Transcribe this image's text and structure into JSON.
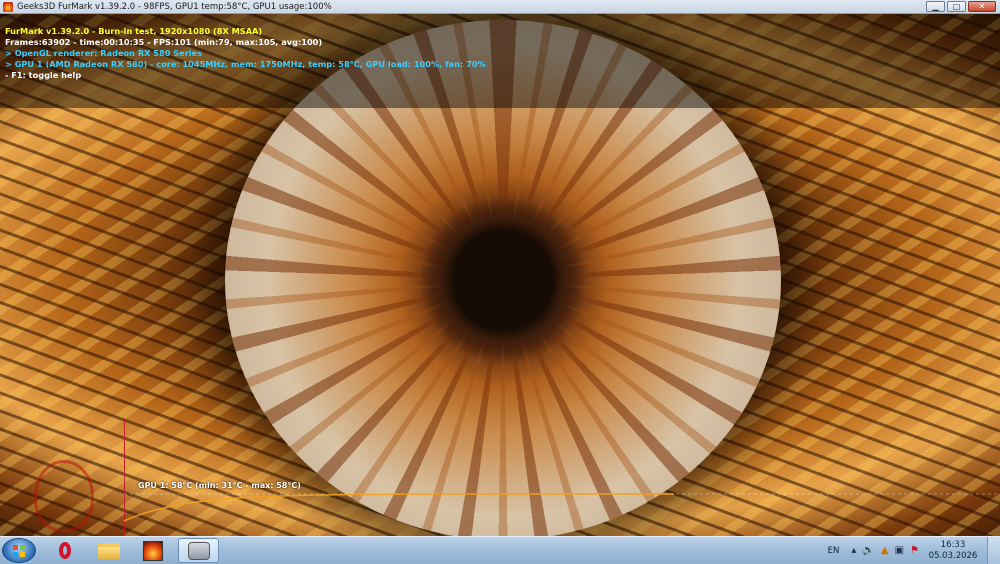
{
  "window": {
    "title": "Geeks3D FurMark v1.39.2.0 - 98FPS, GPU1 temp:58°C, GPU1 usage:100%",
    "controls": {
      "minimize": "▁",
      "maximize": "□",
      "close": "✕"
    }
  },
  "osd": {
    "lines": [
      {
        "text": "FurMark v1.39.2.0 - Burn-in test, 1920x1080 (8X MSAA)",
        "color": "#ffff30"
      },
      {
        "text": "Frames:63902 - time:00:10:35 - FPS:101 (min:79, max:105, avg:100)",
        "color": "#ffffff"
      },
      {
        "text": "> OpenGL renderer: Radeon RX 580 Series",
        "color": "#3ad0ff"
      },
      {
        "text": "> GPU 1 (AMD Radeon RX 580) - core: 1045MHz, mem: 1750MHz, temp: 58°C, GPU load: 100%, fan: 70%",
        "color": "#3ad0ff"
      },
      {
        "text": "- F1: toggle help",
        "color": "#ffffff"
      }
    ]
  },
  "graph": {
    "label": "GPU 1: 58°C (min: 31°C - max: 58°C)",
    "line_color": "#f0a020",
    "temperature_min": 31,
    "temperature_max": 58,
    "temperature_current": 58
  },
  "taskbar": {
    "apps": [
      {
        "name": "opera",
        "icon": "opera-icon",
        "active": false
      },
      {
        "name": "file-explorer",
        "icon": "folder-icon",
        "active": false
      },
      {
        "name": "furmark",
        "icon": "furmark-icon",
        "active": false
      },
      {
        "name": "gpu-tool",
        "icon": "gpu-icon",
        "active": true
      }
    ],
    "tray": {
      "language": "EN",
      "icons": [
        "arrow-up-icon",
        "volume-icon",
        "warning-icon",
        "network-icon",
        "flag-icon"
      ],
      "time": "16:33",
      "date": "05.03.2026"
    }
  }
}
